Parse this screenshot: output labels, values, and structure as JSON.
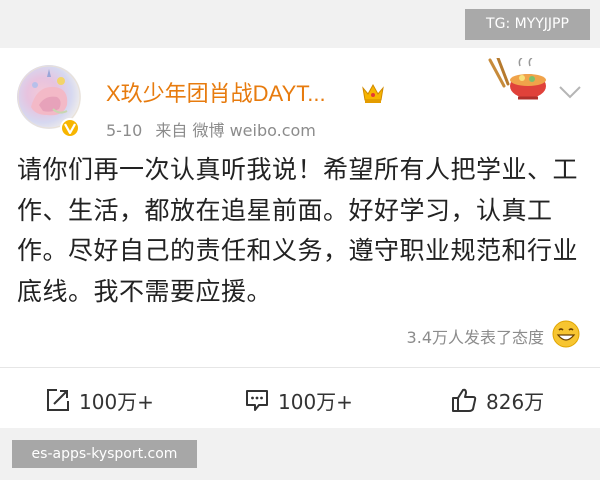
{
  "overlay": {
    "tg_badge": "TG: MYYJJPP",
    "watermark": "es-apps-kysport.com"
  },
  "post": {
    "author_name": "X玖少年团肖战DAYT...",
    "date": "5-10",
    "source": "来自 微博 weibo.com",
    "text": "请你们再一次认真听我说！希望所有人把学业、工作、生活，都放在追星前面。好好学习，认真工作。尽好自己的责任和义务，遵守职业规范和行业底线。我不需要应援。",
    "reactions_text": "3.4万人发表了态度"
  },
  "actions": {
    "repost_count": "100万+",
    "comment_count": "100万+",
    "like_count": "826万"
  },
  "icons": {
    "verified": "verified-badge-icon",
    "crown": "crown-icon",
    "decoration": "hotpot-sticker-icon",
    "menu": "chevron-down-icon",
    "emoji": "grinning-emoji-icon",
    "repost": "repost-icon",
    "comment": "comment-icon",
    "like": "thumbs-up-icon"
  },
  "colors": {
    "name": "#e77b0e",
    "meta": "#8c8c8c",
    "text": "#222222",
    "verified": "#f7b500"
  }
}
